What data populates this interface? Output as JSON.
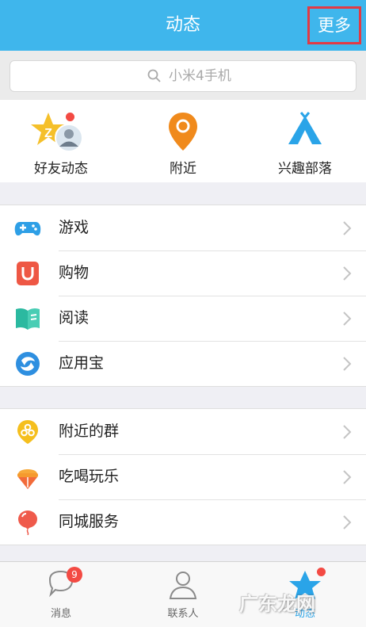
{
  "header": {
    "title": "动态",
    "more_label": "更多"
  },
  "search": {
    "placeholder": "小米4手机"
  },
  "quick_items": [
    {
      "label": "好友动态",
      "icon": "friend-star-icon"
    },
    {
      "label": "附近",
      "icon": "location-pin-icon"
    },
    {
      "label": "兴趣部落",
      "icon": "tent-icon"
    }
  ],
  "group1": [
    {
      "label": "游戏",
      "icon": "gamepad-icon"
    },
    {
      "label": "购物",
      "icon": "shopping-bag-icon"
    },
    {
      "label": "阅读",
      "icon": "book-icon"
    },
    {
      "label": "应用宝",
      "icon": "app-store-icon"
    }
  ],
  "group2": [
    {
      "label": "附近的群",
      "icon": "nearby-group-icon"
    },
    {
      "label": "吃喝玩乐",
      "icon": "ice-cream-icon"
    },
    {
      "label": "同城服务",
      "icon": "balloon-icon"
    }
  ],
  "tabs": [
    {
      "label": "消息",
      "badge": "9"
    },
    {
      "label": "联系人"
    },
    {
      "label": "动态"
    }
  ],
  "watermark": "广东龙网",
  "colors": {
    "header": "#3fb6ec",
    "highlight": "#e23a44",
    "badge": "#f34a43"
  }
}
